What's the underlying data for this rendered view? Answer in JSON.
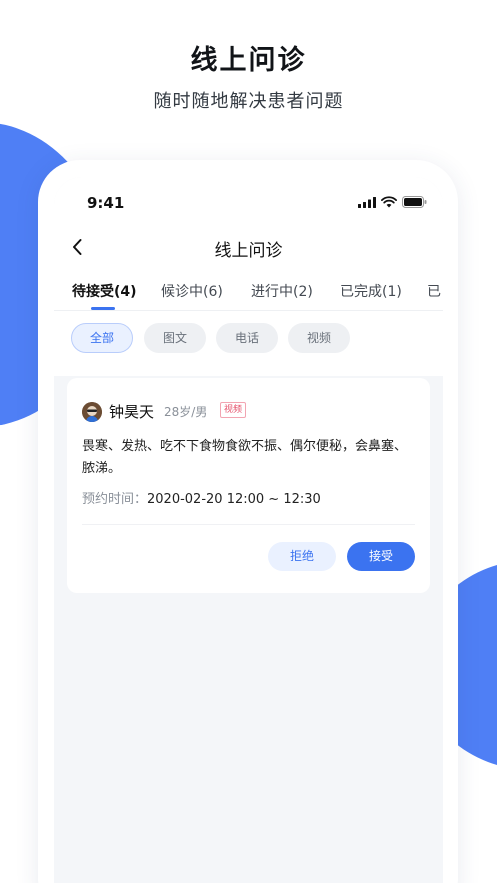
{
  "promo": {
    "title": "线上问诊",
    "subtitle": "随时随地解决患者问题"
  },
  "status_bar": {
    "time": "9:41",
    "icons": [
      "signal-icon",
      "wifi-icon",
      "battery-icon"
    ]
  },
  "nav": {
    "title": "线上问诊",
    "back_icon": "chevron-left-icon"
  },
  "tabs": [
    {
      "label": "待接受(4)",
      "active": true
    },
    {
      "label": "候诊中(6)",
      "active": false
    },
    {
      "label": "进行中(2)",
      "active": false
    },
    {
      "label": "已完成(1)",
      "active": false
    },
    {
      "label": "已",
      "active": false
    }
  ],
  "filters": [
    {
      "label": "全部",
      "active": true
    },
    {
      "label": "图文",
      "active": false
    },
    {
      "label": "电话",
      "active": false
    },
    {
      "label": "视频",
      "active": false
    }
  ],
  "consultation": {
    "patient_name": "钟昊天",
    "meta": "28岁/男",
    "type_badge": "视频",
    "symptoms": "畏寒、发热、吃不下食物食欲不振、偶尔便秘，会鼻塞、脓涕。",
    "appointment_label": "预约时间：",
    "appointment_time": "2020-02-20 12:00 ~ 12:30",
    "reject_label": "拒绝",
    "accept_label": "接受"
  },
  "colors": {
    "accent": "#3b73f0",
    "blob": "#4f7ff5",
    "badge": "#e4506a"
  }
}
